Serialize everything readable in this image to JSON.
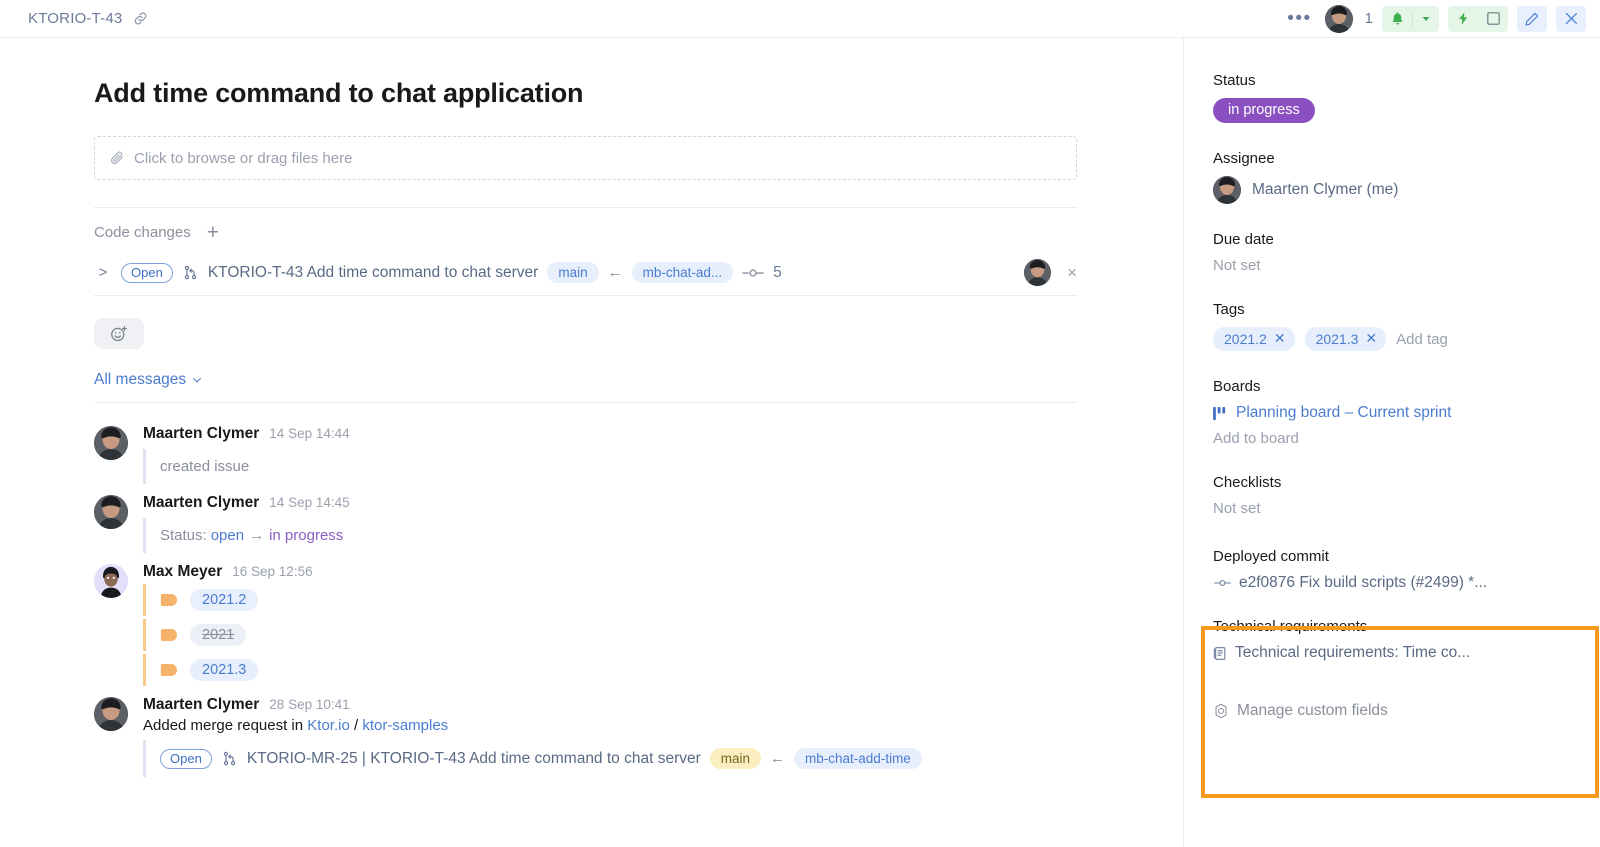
{
  "header": {
    "issue_id": "KTORIO-T-43",
    "link_icon": "link-icon",
    "more_icon": "•••",
    "mention_count": "1",
    "bell_icon": "bell-icon",
    "chevron_icon": "chevron-down-icon",
    "lightning_icon": "lightning-icon",
    "square_icon": "square-icon",
    "pencil_icon": "pencil-icon",
    "close_icon": "×"
  },
  "main": {
    "title": "Add time command to chat application",
    "dropzone_text": "Click to browse or drag files here",
    "code_changes_label": "Code changes",
    "add_label": "+",
    "merge_request": {
      "chevron": ">",
      "state": "Open",
      "title": "KTORIO-T-43 Add time command to chat server",
      "target_branch": "main",
      "source_branch": "mb-chat-ad...",
      "commit_count": "5",
      "close": "×"
    },
    "messages_filter": "All messages",
    "messages": [
      {
        "author": "Maarten Clymer",
        "time": "14 Sep 14:44",
        "event_text": "created issue"
      },
      {
        "author": "Maarten Clymer",
        "time": "14 Sep 14:45",
        "status_label": "Status:",
        "status_from": "open",
        "status_arrow": "→",
        "status_to": "in progress"
      },
      {
        "author": "Max Meyer",
        "time": "16 Sep 12:56",
        "tags": [
          {
            "text": "2021.2",
            "struck": false
          },
          {
            "text": "2021",
            "struck": true
          },
          {
            "text": "2021.3",
            "struck": false
          }
        ]
      },
      {
        "author": "Maarten Clymer",
        "time": "28 Sep 10:41",
        "sub_prefix": "Added merge request in",
        "sub_project": "Ktor.io",
        "sub_sep": "/",
        "sub_repo": "ktor-samples",
        "mr": {
          "state": "Open",
          "title": "KTORIO-MR-25 | KTORIO-T-43 Add time command to chat server",
          "target_branch": "main",
          "source_branch": "mb-chat-add-time"
        }
      }
    ]
  },
  "sidebar": {
    "status_label": "Status",
    "status_value": "in progress",
    "assignee_label": "Assignee",
    "assignee_value": "Maarten Clymer (me)",
    "due_date_label": "Due date",
    "due_date_value": "Not set",
    "tags_label": "Tags",
    "tags": [
      "2021.2",
      "2021.3"
    ],
    "add_tag_label": "Add tag",
    "boards_label": "Boards",
    "board_value": "Planning board – Current sprint",
    "add_board_label": "Add to board",
    "checklists_label": "Checklists",
    "checklists_value": "Not set",
    "deployed_commit_label": "Deployed commit",
    "deployed_commit_value": "e2f0876 Fix build scripts (#2499) *...",
    "tech_req_label": "Technical requirements",
    "tech_req_value": "Technical requirements: Time co...",
    "manage_custom_fields": "Manage custom fields"
  },
  "colors": {
    "status_purple": "#8a4fc0",
    "link_blue": "#4a7ccf",
    "highlight_orange": "#f59a1e",
    "green": "#3fae4c",
    "tag_orange": "#f6b26b"
  }
}
